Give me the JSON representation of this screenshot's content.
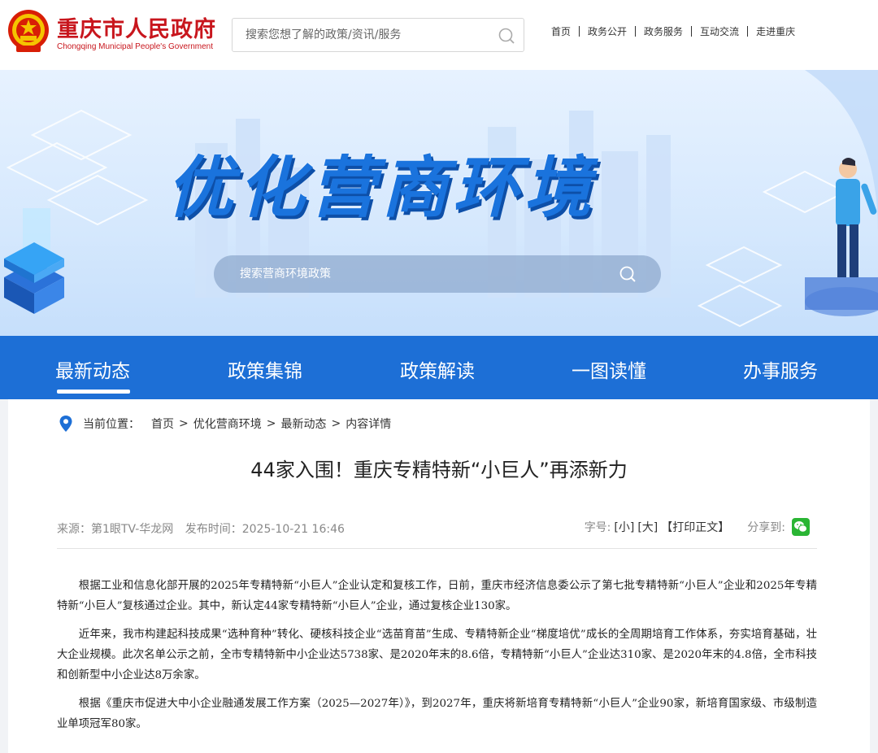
{
  "header": {
    "site_title": "重庆市人民政府",
    "site_subtitle": "Chongqing Municipal People's Government",
    "search_placeholder": "搜索您想了解的政策/资讯/服务",
    "nav": [
      "首页",
      "政务公开",
      "政务服务",
      "互动交流",
      "走进重庆"
    ]
  },
  "banner": {
    "title": "优化营商环境",
    "search_placeholder": "搜索营商环境政策"
  },
  "main_nav": {
    "tabs": [
      "最新动态",
      "政策集锦",
      "政策解读",
      "一图读懂",
      "办事服务"
    ],
    "active_index": 0
  },
  "breadcrumb": {
    "label": "当前位置：",
    "items": [
      "首页",
      "优化营商环境",
      "最新动态",
      "内容详情"
    ],
    "separator": ">"
  },
  "article": {
    "title": "44家入围！重庆专精特新“小巨人”再添新力",
    "source": "来源：第1眼TV-华龙网",
    "published": "发布时间：2025-10-21 16:46",
    "font_label": "字号:",
    "font_small": "[小]",
    "font_large": "[大]",
    "print_label": "【打印正文】",
    "share_label": "分享到:",
    "paragraphs": [
      "根据工业和信息化部开展的2025年专精特新“小巨人”企业认定和复核工作，日前，重庆市经济信息委公示了第七批专精特新“小巨人”企业和2025年专精特新“小巨人”复核通过企业。其中，新认定44家专精特新“小巨人”企业，通过复核企业130家。",
      "近年来，我市构建起科技成果“选种育种”转化、硬核科技企业“选苗育苗”生成、专精特新企业“梯度培优”成长的全周期培育工作体系，夯实培育基础，壮大企业规模。此次名单公示之前，全市专精特新中小企业达5738家、是2020年末的8.6倍，专精特新“小巨人”企业达310家、是2020年末的4.8倍，全市科技和创新型中小企业达8万余家。",
      "根据《重庆市促进大中小企业融通发展工作方案（2025—2027年）》，到2027年，重庆将新培育专精特新“小巨人”企业90家，新培育国家级、市级制造业单项冠军80家。"
    ]
  },
  "colors": {
    "brand_red": "#c8161d",
    "nav_blue": "#1d6fd6",
    "banner_title_blue": "#1a73dd"
  }
}
